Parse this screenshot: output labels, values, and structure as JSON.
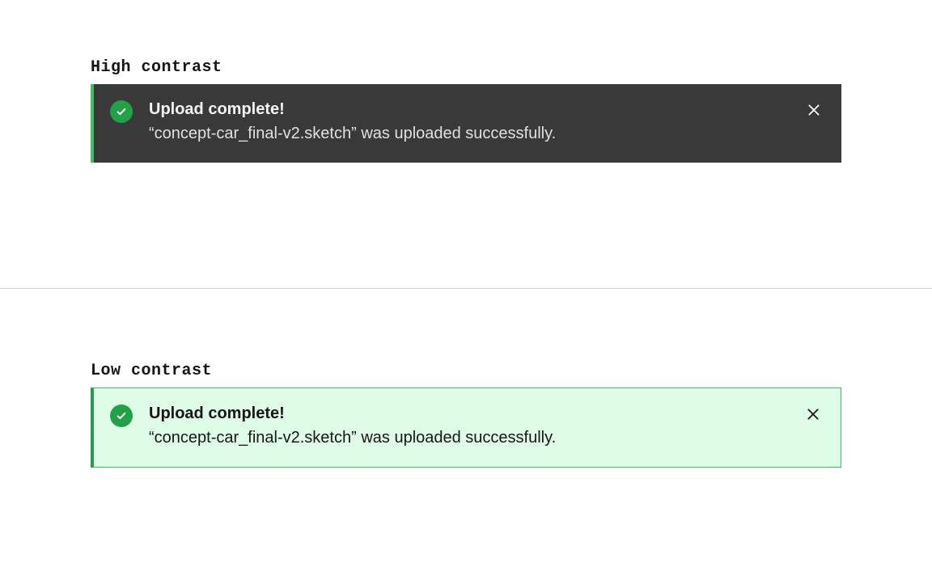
{
  "high": {
    "label": "High contrast",
    "title": "Upload complete!",
    "body": "“concept-car_final-v2.sketch” was uploaded successfully.",
    "accent": "#42be65",
    "bg": "#393939",
    "iconBg": "#24a148"
  },
  "low": {
    "label": "Low contrast",
    "title": "Upload complete!",
    "body": "“concept-car_final-v2.sketch” was uploaded successfully.",
    "accent": "#42be65",
    "bg": "#defbe6",
    "iconBg": "#24a148"
  }
}
